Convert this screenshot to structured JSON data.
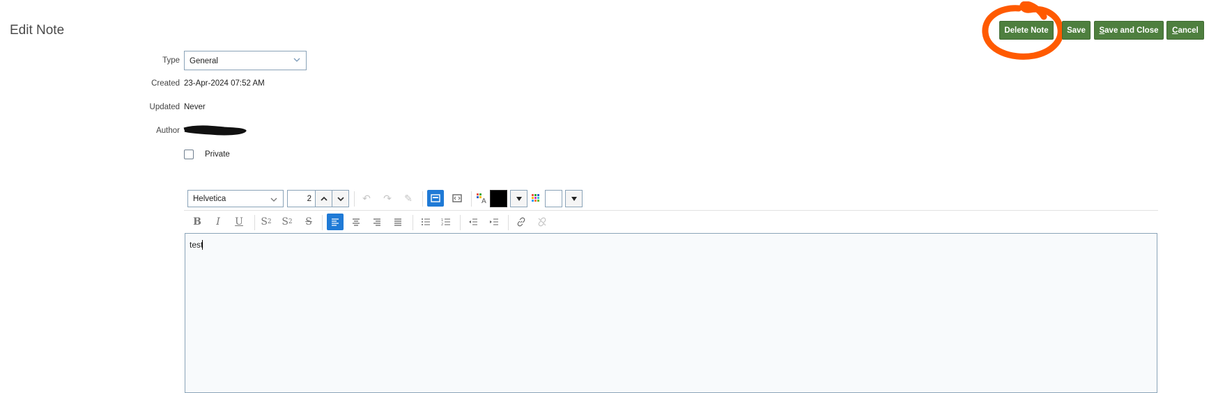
{
  "page": {
    "title": "Edit Note"
  },
  "actions": {
    "delete_note": "Delete Note",
    "save": "Save",
    "save_and_close_first": "S",
    "save_and_close_rest": "ave and Close",
    "cancel_first": "C",
    "cancel_rest": "ancel"
  },
  "annotation": {
    "color": "#ff5a00"
  },
  "form": {
    "type_label": "Type",
    "type_value": "General",
    "created_label": "Created",
    "created_value": "23-Apr-2024 07:52 AM",
    "updated_label": "Updated",
    "updated_value": "Never",
    "author_label": "Author",
    "private_label": "Private"
  },
  "toolbar": {
    "font_family": "Helvetica",
    "font_size": "2",
    "text_color": "#000000",
    "background_color": "#ffffff"
  },
  "editor": {
    "content": "test"
  },
  "colors": {
    "primary_button": "#4e7f3f",
    "active_tool": "#1f7ad6"
  }
}
